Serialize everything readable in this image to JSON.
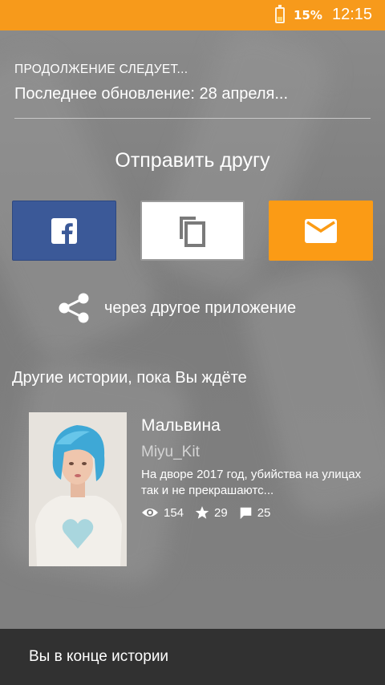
{
  "status_bar": {
    "battery_percent": "15%",
    "time": "12:15"
  },
  "header": {
    "continued_label": "ПРОДОЛЖЕНИЕ СЛЕДУЕТ...",
    "last_update": "Последнее обновление: 28 апреля..."
  },
  "share": {
    "title": "Отправить другу",
    "buttons": [
      {
        "name": "facebook",
        "icon": "facebook-icon",
        "color": "#3b5998"
      },
      {
        "name": "copy-link",
        "icon": "copy-icon",
        "color": "#ffffff"
      },
      {
        "name": "email",
        "icon": "mail-icon",
        "color": "#fb9b15"
      }
    ],
    "other_app_label": "через другое приложение"
  },
  "stories": {
    "section_title": "Другие истории, пока Вы ждёте",
    "items": [
      {
        "title": "Мальвина",
        "author": "Miyu_Kit",
        "description": "На дворе 2017 год, убийства на улицах так и не прекрашаютс...",
        "views": "154",
        "votes": "29",
        "comments": "25"
      }
    ]
  },
  "bottom_bar": {
    "label": "Вы в конце истории"
  },
  "colors": {
    "accent": "#f79a1b",
    "overlay": "#7a7a7a",
    "bottom_bar": "#313131"
  }
}
